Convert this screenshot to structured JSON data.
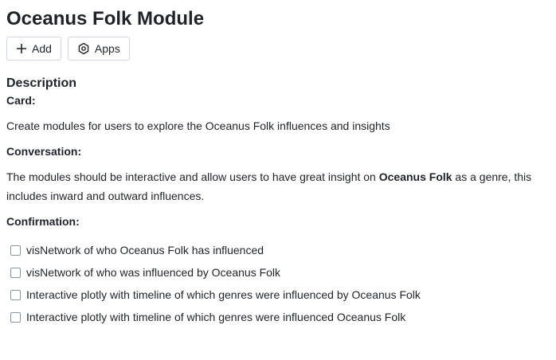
{
  "page": {
    "title": "Oceanus Folk Module"
  },
  "toolbar": {
    "add_label": "Add",
    "apps_label": "Apps"
  },
  "description": {
    "heading": "Description",
    "card_label": "Card:",
    "card_text": "Create modules for users to explore the Oceanus Folk influences and insights",
    "conversation_label": "Conversation:",
    "conversation_text_before": "The modules should be interactive and allow users to have great insight on ",
    "conversation_text_bold": "Oceanus Folk",
    "conversation_text_after": " as a genre, this includes inward and outward influences.",
    "confirmation_label": "Confirmation:"
  },
  "confirmation": {
    "items": [
      {
        "label": "visNetwork of who Oceanus Folk has influenced",
        "checked": false
      },
      {
        "label": "visNetwork of who was influenced by Oceanus Folk",
        "checked": false
      },
      {
        "label": "Interactive plotly with timeline of which genres were influenced by Oceanus Folk",
        "checked": false
      },
      {
        "label": "Interactive plotly with timeline of which genres were influenced  Oceanus Folk",
        "checked": false
      }
    ]
  }
}
